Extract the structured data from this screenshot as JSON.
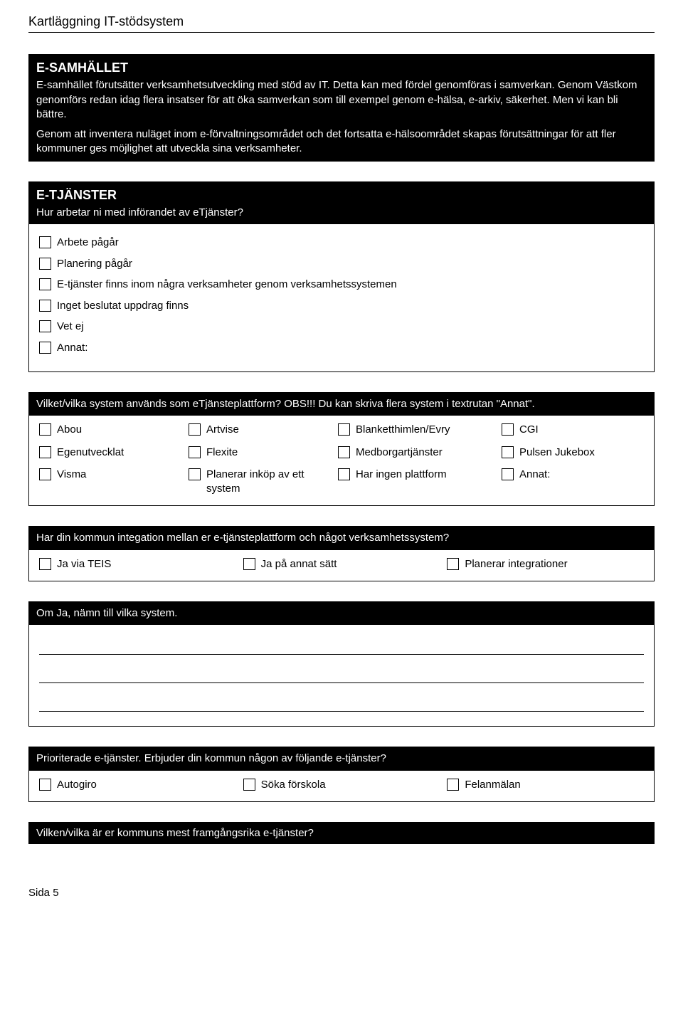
{
  "doc_title": "Kartläggning IT-stödsystem",
  "footer": "Sida 5",
  "section_esamhallet": {
    "heading": "E-SAMHÄLLET",
    "paragraphs": [
      "E-samhället förutsätter verksamhetsutveckling med stöd av IT. Detta kan med fördel genomföras i samverkan. Genom Västkom genomförs redan idag flera insatser för att öka samverkan som till exempel genom e-hälsa, e-arkiv, säkerhet. Men vi kan bli bättre.",
      "Genom att inventera nuläget inom e-förvaltningsområdet och det fortsatta e-hälsoområdet skapas förutsättningar för att fler kommuner ges möjlighet att utveckla sina verksamheter."
    ]
  },
  "section_etjanster": {
    "heading": "E-TJÄNSTER",
    "question": "Hur arbetar ni med införandet av eTjänster?",
    "options": [
      "Arbete pågår",
      "Planering pågår",
      "E-tjänster finns inom några verksamheter genom verksamhetssystemen",
      "Inget beslutat uppdrag finns",
      "Vet ej",
      "Annat:"
    ]
  },
  "section_platform": {
    "question": "Vilket/vilka system används som eTjänsteplattform?  OBS!!! Du kan skriva flera system i textrutan \"Annat\".",
    "options": [
      [
        "Abou",
        "Artvise",
        "Blanketthimlen/Evry",
        "CGI"
      ],
      [
        "Egenutvecklat",
        "Flexite",
        "Medborgartjänster",
        "Pulsen Jukebox"
      ],
      [
        "Visma",
        "Planerar inköp av ett system",
        "Har ingen plattform",
        "Annat:"
      ]
    ]
  },
  "section_integration": {
    "question": "Har din kommun integation mellan er e-tjänsteplattform och något verksamhetssystem?",
    "options": [
      "Ja via TEIS",
      "Ja på annat sätt",
      "Planerar integrationer"
    ]
  },
  "section_omja": {
    "heading": "Om Ja, nämn till vilka system."
  },
  "section_prioriterade": {
    "question": "Prioriterade e-tjänster. Erbjuder din kommun någon av följande e-tjänster?",
    "options": [
      "Autogiro",
      "Söka förskola",
      "Felanmälan"
    ]
  },
  "section_framgang": {
    "question": "Vilken/vilka är er kommuns mest framgångsrika e-tjänster?"
  }
}
